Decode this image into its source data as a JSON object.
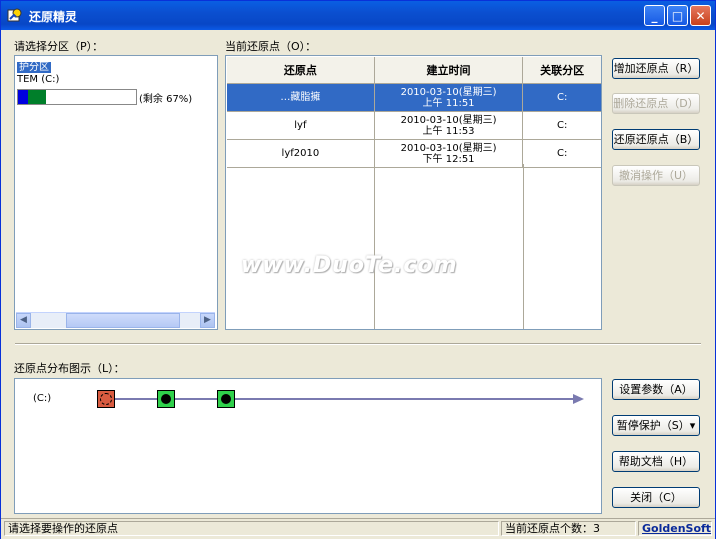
{
  "window": {
    "title": "还原精灵"
  },
  "partitions": {
    "label": "请选择分区（P）：",
    "items": [
      {
        "label": "护分区",
        "selected": true
      },
      {
        "label": "TEM (C:)"
      }
    ],
    "usage_text": "(剩余 67%)",
    "free_percent": 67
  },
  "restore_points": {
    "label": "当前还原点（O）：",
    "columns": [
      "还原点",
      "建立时间",
      "关联分区"
    ],
    "rows": [
      {
        "name": "…藏脂擁",
        "date": "2010-03-10(星期三)",
        "time": "上午 11:51",
        "partition": "C:",
        "selected": true
      },
      {
        "name": "lyf",
        "date": "2010-03-10(星期三)",
        "time": "上午 11:53",
        "partition": "C:"
      },
      {
        "name": "lyf2010",
        "date": "2010-03-10(星期三)",
        "time": "下午 12:51",
        "partition": "C:"
      }
    ]
  },
  "buttons_top": {
    "add": "增加还原点（R）",
    "delete": "删除还原点（D）",
    "restore": "还原还原点（B）",
    "undo": "撤消操作（U）"
  },
  "distribution": {
    "label": "还原点分布图示（L）：",
    "drive": "(C:)"
  },
  "buttons_bottom": {
    "settings": "设置参数（A）",
    "pause": "暂停保护（S）",
    "help": "帮助文档（H）",
    "close": "关闭（C）"
  },
  "status": {
    "hint": "请选择要操作的还原点",
    "count": "当前还原点个数：3",
    "brand": "GoldenSoft"
  },
  "watermark": "www.DuoTe.com",
  "colors": {
    "title": "#0a5fe3",
    "selection": "#316ac5",
    "node": "#2fd04b",
    "node_current": "#d95b40"
  }
}
